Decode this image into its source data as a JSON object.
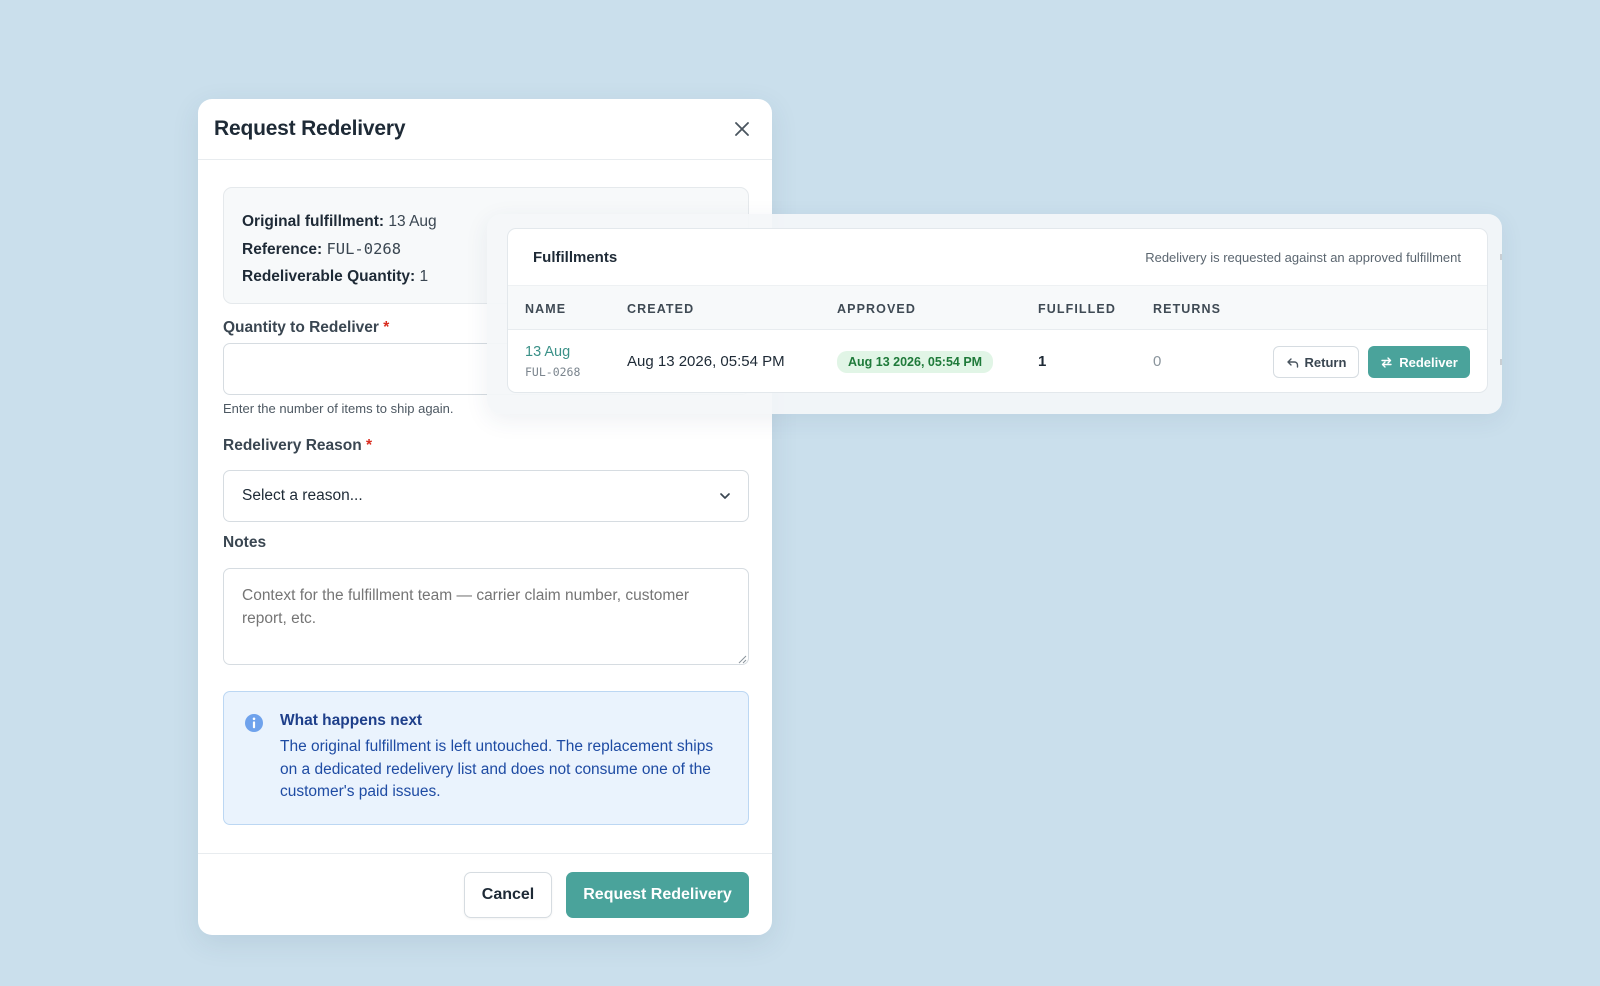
{
  "modal": {
    "title": "Request Redelivery",
    "summary": {
      "original_label": "Original fulfillment:",
      "original_value": "13 Aug",
      "reference_label": "Reference:",
      "reference_value": "FUL-0268",
      "quantity_label": "Redeliverable Quantity:",
      "quantity_value": "1"
    },
    "quantity_field": {
      "label": "Quantity to Redeliver",
      "required_mark": "*",
      "value": "",
      "hint": "Enter the number of items to ship again."
    },
    "reason_field": {
      "label": "Redelivery Reason",
      "required_mark": "*",
      "selected": "Select a reason..."
    },
    "notes_field": {
      "label": "Notes",
      "placeholder": "Context for the fulfillment team — carrier claim number, customer report, etc."
    },
    "callout": {
      "title": "What happens next",
      "body": "The original fulfillment is left untouched. The replacement ships on a dedicated redelivery list and does not consume one of the customer's paid issues."
    },
    "footer": {
      "cancel_label": "Cancel",
      "submit_label": "Request Redelivery"
    }
  },
  "fulfillments": {
    "title": "Fulfillments",
    "note": "Redelivery is requested against an approved fulfillment",
    "columns": [
      "NAME",
      "CREATED",
      "APPROVED",
      "FULFILLED",
      "RETURNS"
    ],
    "rows": [
      {
        "name": "13 Aug",
        "ref": "FUL-0268",
        "created": "Aug 13 2026, 05:54 PM",
        "approved": "Aug 13 2026, 05:54 PM",
        "fulfilled": "1",
        "returns": "0",
        "return_label": "Return",
        "redeliver_label": "Redeliver"
      }
    ]
  },
  "colors": {
    "accent": "#4aa39b",
    "background": "#cadfec",
    "approved_badge": "#e1f5e6",
    "callout_bg": "#eaf3fd"
  },
  "icons": [
    "close-icon",
    "chevron-down-icon",
    "info-icon",
    "return-arrow-icon",
    "swap-arrows-icon",
    "resize-grip-icon"
  ]
}
